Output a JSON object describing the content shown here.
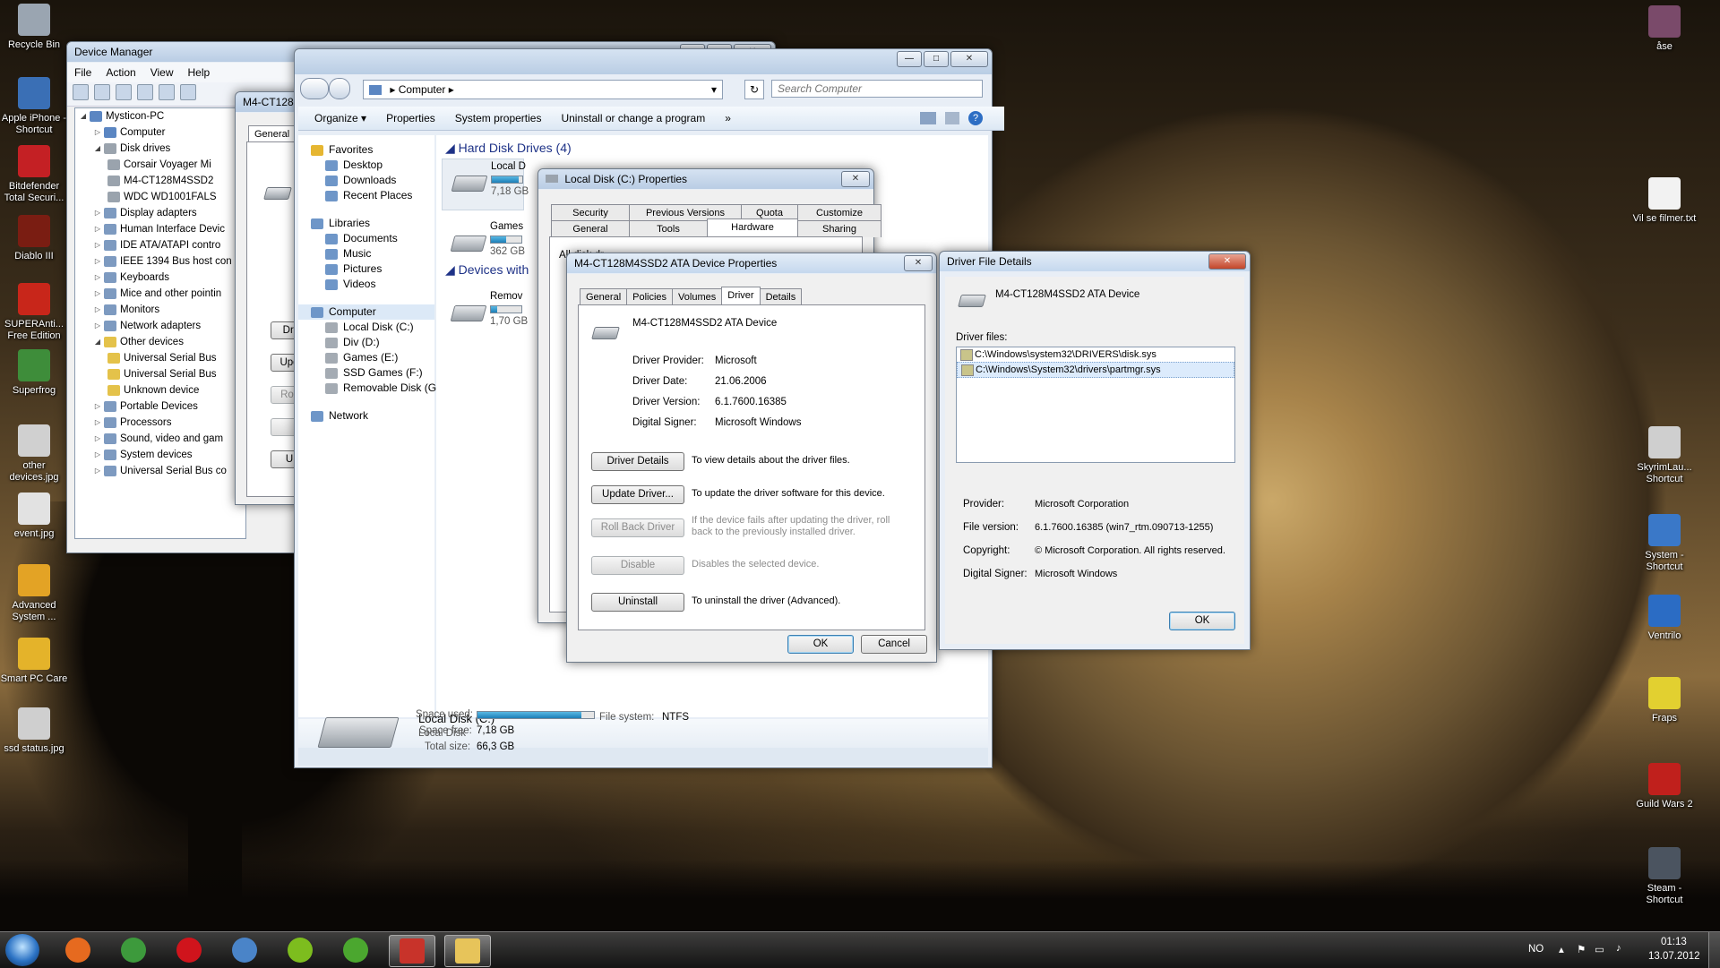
{
  "desktop": {
    "left_icons": [
      {
        "label": "Recycle Bin",
        "icon": "recycle-bin-icon",
        "color": "#9aa5b1"
      },
      {
        "label": "Apple iPhone - Shortcut",
        "icon": "iphone-icon",
        "color": "#3a6fb5"
      },
      {
        "label": "Bitdefender Total Securi...",
        "icon": "bitdefender-icon",
        "color": "#c42024"
      },
      {
        "label": "Diablo III",
        "icon": "diablo-icon",
        "color": "#7a1d12"
      },
      {
        "label": "SUPERAnti... Free Edition",
        "icon": "superantispyware-icon",
        "color": "#c8261a"
      },
      {
        "label": "Superfrog",
        "icon": "superfrog-icon",
        "color": "#3e8d3a"
      },
      {
        "label": "other devices.jpg",
        "icon": "image-file-icon",
        "color": "#d0d0d0"
      },
      {
        "label": "event.jpg",
        "icon": "image-file-icon",
        "color": "#e2e2e2"
      },
      {
        "label": "Advanced System ...",
        "icon": "advanced-systemcare-icon",
        "color": "#e3a325"
      },
      {
        "label": "Smart PC Care",
        "icon": "smart-pc-care-icon",
        "color": "#e4b32a"
      },
      {
        "label": "ssd status.jpg",
        "icon": "image-file-icon",
        "color": "#cfcfcf"
      }
    ],
    "right_icons": [
      {
        "label": "åse",
        "icon": "photo-file-icon",
        "color": "#7a4a6a"
      },
      {
        "label": "Vil se filmer.txt",
        "icon": "text-file-icon",
        "color": "#f2f2f2"
      },
      {
        "label": "SkyrimLau... Shortcut",
        "icon": "skyrim-icon",
        "color": "#cfcfcf"
      },
      {
        "label": "System - Shortcut",
        "icon": "system-icon",
        "color": "#3a78c8"
      },
      {
        "label": "Ventrilo",
        "icon": "ventrilo-icon",
        "color": "#2b6cc4"
      },
      {
        "label": "Fraps",
        "icon": "fraps-icon",
        "color": "#e2d030"
      },
      {
        "label": "Guild Wars 2",
        "icon": "guild-wars-icon",
        "color": "#c0201c"
      },
      {
        "label": "Steam - Shortcut",
        "icon": "steam-icon",
        "color": "#4b5460"
      }
    ]
  },
  "device_manager": {
    "title": "Device Manager",
    "menu": [
      "File",
      "Action",
      "View",
      "Help"
    ],
    "tree": [
      {
        "label": "Mysticon-PC",
        "expander": "◢",
        "icon": "pc"
      },
      {
        "label": "Computer",
        "expander": "▷",
        "icon": "pc"
      },
      {
        "label": "Disk drives",
        "expander": "◢",
        "icon": "drive"
      },
      {
        "label": "Corsair Voyager Mi",
        "expander": "",
        "icon": "drive"
      },
      {
        "label": "M4-CT128M4SSD2",
        "expander": "",
        "icon": "drive"
      },
      {
        "label": "WDC WD1001FALS",
        "expander": "",
        "icon": "drive"
      },
      {
        "label": "Display adapters",
        "expander": "▷",
        "icon": "dev"
      },
      {
        "label": "Human Interface Devic",
        "expander": "▷",
        "icon": "dev"
      },
      {
        "label": "IDE ATA/ATAPI contro",
        "expander": "▷",
        "icon": "dev"
      },
      {
        "label": "IEEE 1394 Bus host con",
        "expander": "▷",
        "icon": "dev"
      },
      {
        "label": "Keyboards",
        "expander": "▷",
        "icon": "dev"
      },
      {
        "label": "Mice and other pointin",
        "expander": "▷",
        "icon": "dev"
      },
      {
        "label": "Monitors",
        "expander": "▷",
        "icon": "dev"
      },
      {
        "label": "Network adapters",
        "expander": "▷",
        "icon": "dev"
      },
      {
        "label": "Other devices",
        "expander": "◢",
        "icon": "warn"
      },
      {
        "label": "Universal Serial Bus",
        "expander": "",
        "icon": "warn"
      },
      {
        "label": "Universal Serial Bus",
        "expander": "",
        "icon": "warn"
      },
      {
        "label": "Unknown device",
        "expander": "",
        "icon": "warn"
      },
      {
        "label": "Portable Devices",
        "expander": "▷",
        "icon": "dev"
      },
      {
        "label": "Processors",
        "expander": "▷",
        "icon": "dev"
      },
      {
        "label": "Sound, video and gam",
        "expander": "▷",
        "icon": "dev"
      },
      {
        "label": "System devices",
        "expander": "▷",
        "icon": "dev"
      },
      {
        "label": "Universal Serial Bus co",
        "expander": "▷",
        "icon": "dev"
      }
    ]
  },
  "behind_props": {
    "title": "M4-CT128",
    "tab": "General",
    "buttons": [
      "Dri",
      "Upd",
      "Roll",
      "",
      "U"
    ]
  },
  "explorer": {
    "address": "Computer",
    "search_placeholder": "Search Computer",
    "commands": [
      "Organize ▾",
      "Properties",
      "System properties",
      "Uninstall or change a program",
      "»"
    ],
    "favorites_header": "Favorites",
    "favorites": [
      "Desktop",
      "Downloads",
      "Recent Places"
    ],
    "libraries_header": "Libraries",
    "libraries": [
      "Documents",
      "Music",
      "Pictures",
      "Videos"
    ],
    "computer_header": "Computer",
    "computer_items": [
      "Local Disk (C:)",
      "Div (D:)",
      "Games (E:)",
      "SSD Games (F:)",
      "Removable Disk (G:)"
    ],
    "network_label": "Network",
    "hdd_section": "Hard Disk Drives (4)",
    "devices_section": "Devices with",
    "drives": [
      {
        "name": "Local D",
        "size": "7,18 GB",
        "fill": 0.89
      },
      {
        "name": "Games",
        "size": "362 GB",
        "fill": 0.5
      },
      {
        "name": "Remov",
        "size": "1,70 GB",
        "fill": 0.2
      }
    ],
    "details": {
      "name": "Local Disk (C:)",
      "type": "Local Disk",
      "space_used_label": "Space used:",
      "space_used_fraction": 0.89,
      "space_free_label": "Space free:",
      "space_free": "7,18 GB",
      "total_size_label": "Total size:",
      "total_size": "66,3 GB",
      "fs_label": "File system:",
      "fs": "NTFS"
    }
  },
  "local_disk_props": {
    "title": "Local Disk (C:) Properties",
    "tabs_row1": [
      "Security",
      "Previous Versions",
      "Quota",
      "Customize"
    ],
    "tabs_row2": [
      "General",
      "Tools",
      "Hardware",
      "Sharing"
    ],
    "selected_tab": "Hardware",
    "partial_text": "All disk dr"
  },
  "ata_props": {
    "title": "M4-CT128M4SSD2 ATA Device Properties",
    "tabs": [
      "General",
      "Policies",
      "Volumes",
      "Driver",
      "Details"
    ],
    "selected_tab": "Driver",
    "device_name": "M4-CT128M4SSD2 ATA Device",
    "fields": [
      {
        "label": "Driver Provider:",
        "value": "Microsoft"
      },
      {
        "label": "Driver Date:",
        "value": "21.06.2006"
      },
      {
        "label": "Driver Version:",
        "value": "6.1.7600.16385"
      },
      {
        "label": "Digital Signer:",
        "value": "Microsoft Windows"
      }
    ],
    "actions": [
      {
        "button": "Driver Details",
        "desc": "To view details about the driver files.",
        "disabled": false
      },
      {
        "button": "Update Driver...",
        "desc": "To update the driver software for this device.",
        "disabled": false
      },
      {
        "button": "Roll Back Driver",
        "desc": "If the device fails after updating the driver, roll back to the previously installed driver.",
        "disabled": true
      },
      {
        "button": "Disable",
        "desc": "Disables the selected device.",
        "disabled": true
      },
      {
        "button": "Uninstall",
        "desc": "To uninstall the driver (Advanced).",
        "disabled": false
      }
    ],
    "ok": "OK",
    "cancel": "Cancel"
  },
  "driver_file_details": {
    "title": "Driver File Details",
    "device_name": "M4-CT128M4SSD2 ATA Device",
    "files_label": "Driver files:",
    "files": [
      "C:\\Windows\\system32\\DRIVERS\\disk.sys",
      "C:\\Windows\\System32\\drivers\\partmgr.sys"
    ],
    "selected_file_index": 1,
    "info": [
      {
        "label": "Provider:",
        "value": "Microsoft Corporation"
      },
      {
        "label": "File version:",
        "value": "6.1.7600.16385 (win7_rtm.090713-1255)"
      },
      {
        "label": "Copyright:",
        "value": "© Microsoft Corporation. All rights reserved."
      },
      {
        "label": "Digital Signer:",
        "value": "Microsoft Windows"
      }
    ],
    "ok": "OK"
  },
  "taskbar": {
    "apps": [
      {
        "name": "firefox-icon",
        "color": "#e66a1f",
        "active": false
      },
      {
        "name": "chrome-icon",
        "color": "#3d9a3c",
        "active": false
      },
      {
        "name": "opera-icon",
        "color": "#d0141c",
        "active": false
      },
      {
        "name": "control-panel-icon",
        "color": "#4a84c8",
        "active": false
      },
      {
        "name": "spotify-icon",
        "color": "#7dbd1e",
        "active": false
      },
      {
        "name": "utorrent-icon",
        "color": "#4ba72f",
        "active": false
      },
      {
        "name": "toolbox-icon",
        "color": "#c8332a",
        "active": true
      },
      {
        "name": "folder-icon",
        "color": "#e7c45a",
        "active": true
      }
    ],
    "lang": "NO",
    "time": "01:13",
    "date": "13.07.2012"
  }
}
